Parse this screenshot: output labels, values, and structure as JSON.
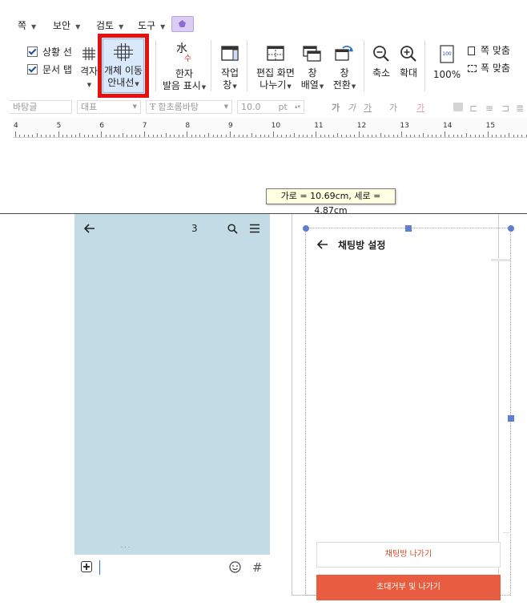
{
  "menubar": {
    "items": [
      {
        "label": "쪽"
      },
      {
        "label": "보안"
      },
      {
        "label": "검토"
      },
      {
        "label": "도구"
      }
    ]
  },
  "ribbon": {
    "checkboxes": [
      {
        "label": "상황 선",
        "checked": true
      },
      {
        "label": "문서 탭",
        "checked": true
      }
    ],
    "grid_label": "격자",
    "object_guide": {
      "line1": "개체 이동",
      "line2": "안내선"
    },
    "hanja": {
      "line1": "한자",
      "line2": "발음 표시"
    },
    "work": {
      "line1": "작업",
      "line2": "창"
    },
    "split": {
      "line1": "편집 화면",
      "line2": "나누기"
    },
    "arrange": {
      "line1": "창",
      "line2": "배열"
    },
    "switch": {
      "line1": "창",
      "line2": "전환"
    },
    "zoom_out": "축소",
    "zoom_in": "확대",
    "zoom_level": "100%",
    "fit_page": "쪽 맞춤",
    "fit_width": "폭 맞춤"
  },
  "formatbar": {
    "font_lang": "바탕글",
    "style": "대표",
    "font": "함초롬바탕",
    "size": "10.0",
    "unit": "pt",
    "bold": "가",
    "italic": "가",
    "underline": "가",
    "strike": "가",
    "color_a": "가"
  },
  "ruler": {
    "numbers": [
      "4",
      "5",
      "6",
      "7",
      "8",
      "9",
      "10",
      "11",
      "12",
      "13",
      "14",
      "15"
    ]
  },
  "tooltip": {
    "text": "가로 = 10.69cm, 세로 = 4.87cm"
  },
  "chat_left": {
    "page_number": "3",
    "background": "#c3dbe4",
    "dots": "· · ·",
    "hash": "#"
  },
  "chat_settings": {
    "title": "채팅방 설정",
    "exit_button": "채팅방 나가기",
    "reject_button": "초대거부 및 나가기"
  },
  "colors": {
    "highlight_red": "#e5100f",
    "selection_blue": "#d9e8fb",
    "accent_orange": "#e85d3f",
    "handle_blue": "#5f7fd1"
  }
}
